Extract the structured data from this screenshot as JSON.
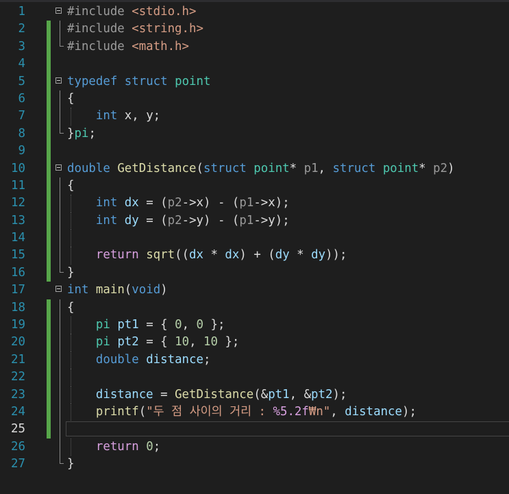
{
  "editor": {
    "language": "C",
    "current_line": 25,
    "lines": [
      {
        "n": "1",
        "tokens": [
          [
            "pp",
            "#include "
          ],
          [
            "st",
            "<stdio.h>"
          ]
        ]
      },
      {
        "n": "2",
        "tokens": [
          [
            "pp",
            "#include "
          ],
          [
            "st",
            "<string.h>"
          ]
        ]
      },
      {
        "n": "3",
        "tokens": [
          [
            "pp",
            "#include "
          ],
          [
            "st",
            "<math.h>"
          ]
        ]
      },
      {
        "n": "4",
        "tokens": []
      },
      {
        "n": "5",
        "tokens": [
          [
            "kw",
            "typedef"
          ],
          [
            "t",
            " "
          ],
          [
            "kw",
            "struct"
          ],
          [
            "t",
            " "
          ],
          [
            "ty",
            "point"
          ]
        ]
      },
      {
        "n": "6",
        "tokens": [
          [
            "t",
            "{"
          ]
        ]
      },
      {
        "n": "7",
        "tokens": [
          [
            "t",
            "    "
          ],
          [
            "kw",
            "int"
          ],
          [
            "t",
            " x, y;"
          ]
        ]
      },
      {
        "n": "8",
        "tokens": [
          [
            "t",
            "}"
          ],
          [
            "ty",
            "pi"
          ],
          [
            "t",
            ";"
          ]
        ]
      },
      {
        "n": "9",
        "tokens": []
      },
      {
        "n": "10",
        "tokens": [
          [
            "kw",
            "double"
          ],
          [
            "t",
            " "
          ],
          [
            "fn",
            "GetDistance"
          ],
          [
            "t",
            "("
          ],
          [
            "kw",
            "struct"
          ],
          [
            "t",
            " "
          ],
          [
            "ty",
            "point"
          ],
          [
            "t",
            "* "
          ],
          [
            "pa",
            "p1"
          ],
          [
            "t",
            ", "
          ],
          [
            "kw",
            "struct"
          ],
          [
            "t",
            " "
          ],
          [
            "ty",
            "point"
          ],
          [
            "t",
            "* "
          ],
          [
            "pa",
            "p2"
          ],
          [
            "t",
            ")"
          ]
        ]
      },
      {
        "n": "11",
        "tokens": [
          [
            "t",
            "{"
          ]
        ]
      },
      {
        "n": "12",
        "tokens": [
          [
            "t",
            "    "
          ],
          [
            "kw",
            "int"
          ],
          [
            "t",
            " "
          ],
          [
            "lv",
            "dx"
          ],
          [
            "t",
            " = ("
          ],
          [
            "pa",
            "p2"
          ],
          [
            "t",
            "->x) - ("
          ],
          [
            "pa",
            "p1"
          ],
          [
            "t",
            "->x);"
          ]
        ]
      },
      {
        "n": "13",
        "tokens": [
          [
            "t",
            "    "
          ],
          [
            "kw",
            "int"
          ],
          [
            "t",
            " "
          ],
          [
            "lv",
            "dy"
          ],
          [
            "t",
            " = ("
          ],
          [
            "pa",
            "p2"
          ],
          [
            "t",
            "->y) - ("
          ],
          [
            "pa",
            "p1"
          ],
          [
            "t",
            "->y);"
          ]
        ]
      },
      {
        "n": "14",
        "tokens": []
      },
      {
        "n": "15",
        "tokens": [
          [
            "t",
            "    "
          ],
          [
            "ctl",
            "return"
          ],
          [
            "t",
            " "
          ],
          [
            "fn",
            "sqrt"
          ],
          [
            "t",
            "(("
          ],
          [
            "lv",
            "dx"
          ],
          [
            "t",
            " * "
          ],
          [
            "lv",
            "dx"
          ],
          [
            "t",
            ") + ("
          ],
          [
            "lv",
            "dy"
          ],
          [
            "t",
            " * "
          ],
          [
            "lv",
            "dy"
          ],
          [
            "t",
            "));"
          ]
        ]
      },
      {
        "n": "16",
        "tokens": [
          [
            "t",
            "}"
          ]
        ]
      },
      {
        "n": "17",
        "tokens": [
          [
            "kw",
            "int"
          ],
          [
            "t",
            " "
          ],
          [
            "fn",
            "main"
          ],
          [
            "t",
            "("
          ],
          [
            "kw",
            "void"
          ],
          [
            "t",
            ")"
          ]
        ]
      },
      {
        "n": "18",
        "tokens": [
          [
            "t",
            "{"
          ]
        ]
      },
      {
        "n": "19",
        "tokens": [
          [
            "t",
            "    "
          ],
          [
            "ty",
            "pi"
          ],
          [
            "t",
            " "
          ],
          [
            "lv",
            "pt1"
          ],
          [
            "t",
            " = { "
          ],
          [
            "nu",
            "0"
          ],
          [
            "t",
            ", "
          ],
          [
            "nu",
            "0"
          ],
          [
            "t",
            " };"
          ]
        ]
      },
      {
        "n": "20",
        "tokens": [
          [
            "t",
            "    "
          ],
          [
            "ty",
            "pi"
          ],
          [
            "t",
            " "
          ],
          [
            "lv",
            "pt2"
          ],
          [
            "t",
            " = { "
          ],
          [
            "nu",
            "10"
          ],
          [
            "t",
            ", "
          ],
          [
            "nu",
            "10"
          ],
          [
            "t",
            " };"
          ]
        ]
      },
      {
        "n": "21",
        "tokens": [
          [
            "t",
            "    "
          ],
          [
            "kw",
            "double"
          ],
          [
            "t",
            " "
          ],
          [
            "lv",
            "distance"
          ],
          [
            "t",
            ";"
          ]
        ]
      },
      {
        "n": "22",
        "tokens": []
      },
      {
        "n": "23",
        "tokens": [
          [
            "t",
            "    "
          ],
          [
            "lv",
            "distance"
          ],
          [
            "t",
            " = "
          ],
          [
            "fn",
            "GetDistance"
          ],
          [
            "t",
            "(&"
          ],
          [
            "lv",
            "pt1"
          ],
          [
            "t",
            ", &"
          ],
          [
            "lv",
            "pt2"
          ],
          [
            "t",
            ");"
          ]
        ]
      },
      {
        "n": "24",
        "tokens": [
          [
            "t",
            "    "
          ],
          [
            "fn",
            "printf"
          ],
          [
            "t",
            "("
          ],
          [
            "st",
            "\"두 점 사이의 거리 : "
          ],
          [
            "fmt",
            "%5.2f"
          ],
          [
            "st",
            "₩n\""
          ],
          [
            "t",
            ", "
          ],
          [
            "lv",
            "distance"
          ],
          [
            "t",
            ");"
          ]
        ]
      },
      {
        "n": "25",
        "tokens": []
      },
      {
        "n": "26",
        "tokens": [
          [
            "t",
            "    "
          ],
          [
            "ctl",
            "return"
          ],
          [
            "t",
            " "
          ],
          [
            "nu",
            "0"
          ],
          [
            "t",
            ";"
          ]
        ]
      },
      {
        "n": "27",
        "tokens": [
          [
            "t",
            "}"
          ]
        ]
      }
    ]
  }
}
